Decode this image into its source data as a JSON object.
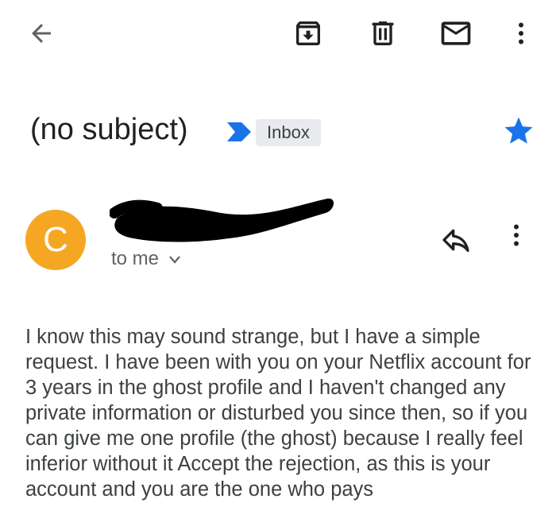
{
  "toolbar": {
    "icons": [
      "back-arrow-icon",
      "archive-icon",
      "trash-icon",
      "mail-icon",
      "more-vert-icon"
    ]
  },
  "message": {
    "subject": "(no subject)",
    "label": "Inbox",
    "starred": true,
    "sender_initial": "C",
    "recipient": "to me",
    "body": "I know this may sound strange, but I have a simple request. I have been with you on your Netflix account for 3 years in the ghost profile and I haven't changed any private information or disturbed you since then, so if you can give me one profile (the ghost) because I really feel inferior without it Accept the rejection, as this is your account and you are the one who pays"
  },
  "colors": {
    "avatar": "#f5a623",
    "star": "#1a73e8",
    "importance": "#1a73e8",
    "label_bg": "#e8eaed"
  }
}
